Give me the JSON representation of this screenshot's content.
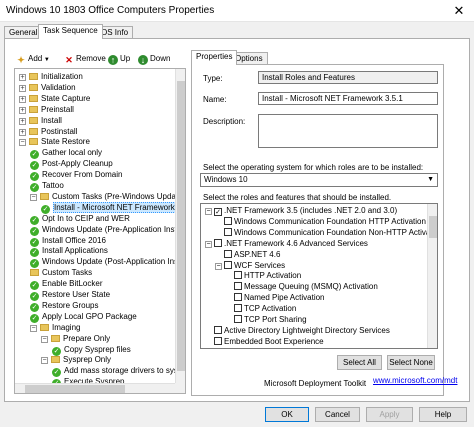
{
  "window": {
    "title": "Windows 10 1803 Office Computers Properties",
    "close_glyph": "✕"
  },
  "tabs": [
    {
      "label": "General"
    },
    {
      "label": "Task Sequence"
    },
    {
      "label": "OS Info"
    }
  ],
  "toolbar": {
    "add": "Add",
    "remove": "Remove",
    "up": "Up",
    "down": "Down"
  },
  "tree": [
    {
      "label": "Initialization",
      "type": "group",
      "level": 0
    },
    {
      "label": "Validation",
      "type": "group",
      "level": 0
    },
    {
      "label": "State Capture",
      "type": "group",
      "level": 0
    },
    {
      "label": "Preinstall",
      "type": "group",
      "level": 0
    },
    {
      "label": "Install",
      "type": "group",
      "level": 0
    },
    {
      "label": "Postinstall",
      "type": "group",
      "level": 0
    },
    {
      "label": "State Restore",
      "type": "group-open",
      "level": 0
    },
    {
      "label": "Gather local only",
      "type": "task",
      "level": 1
    },
    {
      "label": "Post-Apply Cleanup",
      "type": "task",
      "level": 1
    },
    {
      "label": "Recover From Domain",
      "type": "task",
      "level": 1
    },
    {
      "label": "Tattoo",
      "type": "task",
      "level": 1
    },
    {
      "label": "Custom Tasks (Pre-Windows Update)",
      "type": "group-open",
      "level": 1
    },
    {
      "label": "Install - Microsoft NET Framework",
      "type": "task",
      "level": 2,
      "selected": true
    },
    {
      "label": "Opt In to CEIP and WER",
      "type": "task",
      "level": 1
    },
    {
      "label": "Windows Update (Pre-Application Inst",
      "type": "task",
      "level": 1
    },
    {
      "label": "Install Office 2016",
      "type": "task",
      "level": 1
    },
    {
      "label": "Install Applications",
      "type": "task",
      "level": 1
    },
    {
      "label": "Windows Update (Post-Application Ins",
      "type": "task",
      "level": 1
    },
    {
      "label": "Custom Tasks",
      "type": "folder",
      "level": 1
    },
    {
      "label": "Enable BitLocker",
      "type": "task",
      "level": 1
    },
    {
      "label": "Restore User State",
      "type": "task",
      "level": 1
    },
    {
      "label": "Restore Groups",
      "type": "task",
      "level": 1
    },
    {
      "label": "Apply Local GPO Package",
      "type": "task",
      "level": 1
    },
    {
      "label": "Imaging",
      "type": "group-open",
      "level": 1
    },
    {
      "label": "Prepare Only",
      "type": "group-open",
      "level": 2
    },
    {
      "label": "Copy Sysprep files",
      "type": "task",
      "level": 3
    },
    {
      "label": "Sysprep Only",
      "type": "group-open",
      "level": 2
    },
    {
      "label": "Add mass storage drivers to sysprep",
      "type": "task",
      "level": 3
    },
    {
      "label": "Execute Sysprep",
      "type": "task",
      "level": 3
    },
    {
      "label": "",
      "type": "task",
      "level": 3
    }
  ],
  "props": {
    "tabs": [
      {
        "label": "Properties"
      },
      {
        "label": "Options"
      }
    ],
    "type_label": "Type:",
    "type_value": "Install Roles and Features",
    "name_label": "Name:",
    "name_value": "Install - Microsoft NET Framework 3.5.1",
    "desc_label": "Description:",
    "desc_value": "",
    "os_label": "Select the operating system for which roles are to be installed:",
    "os_value": "Windows 10",
    "roles_label": "Select the roles and features that should be installed.",
    "roles": [
      {
        "label": ".NET Framework 3.5 (includes .NET 2.0 and 3.0)",
        "level": 0,
        "expander": "-",
        "checked": true
      },
      {
        "label": "Windows Communication Foundation HTTP Activation",
        "level": 1,
        "expander": "",
        "checked": false
      },
      {
        "label": "Windows Communication Foundation Non-HTTP Activation",
        "level": 1,
        "expander": "",
        "checked": false
      },
      {
        "label": ".NET Framework 4.6 Advanced Services",
        "level": 0,
        "expander": "-",
        "checked": false
      },
      {
        "label": "ASP.NET 4.6",
        "level": 1,
        "expander": "",
        "checked": false
      },
      {
        "label": "WCF Services",
        "level": 1,
        "expander": "-",
        "checked": false
      },
      {
        "label": "HTTP Activation",
        "level": 2,
        "expander": "",
        "checked": false
      },
      {
        "label": "Message Queuing (MSMQ) Activation",
        "level": 2,
        "expander": "",
        "checked": false
      },
      {
        "label": "Named Pipe Activation",
        "level": 2,
        "expander": "",
        "checked": false
      },
      {
        "label": "TCP Activation",
        "level": 2,
        "expander": "",
        "checked": false
      },
      {
        "label": "TCP Port Sharing",
        "level": 2,
        "expander": "",
        "checked": false
      },
      {
        "label": "Active Directory Lightweight Directory Services",
        "level": 0,
        "expander": "",
        "checked": false
      },
      {
        "label": "Embedded Boot Experience",
        "level": 0,
        "expander": "",
        "checked": false
      }
    ],
    "select_all": "Select All",
    "select_none": "Select None",
    "mdt_label": "Microsoft Deployment Toolkit",
    "mdt_link": "www.microsoft.com/mdt"
  },
  "buttons": {
    "ok": "OK",
    "cancel": "Cancel",
    "apply": "Apply",
    "help": "Help"
  },
  "colors": {
    "check_green": "#3fae2a",
    "selection": "#cce8ff",
    "accent": "#0078d7"
  }
}
